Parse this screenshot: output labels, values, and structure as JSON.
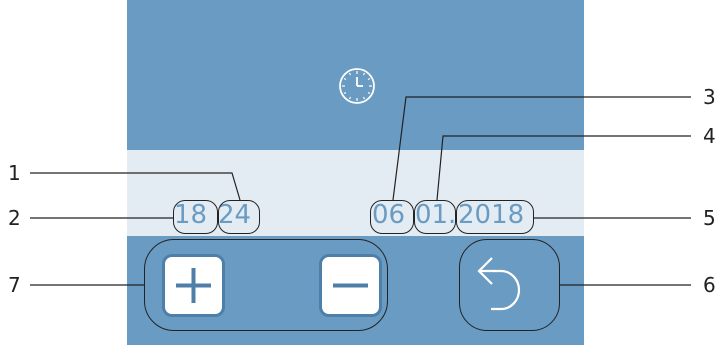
{
  "screen": {
    "background_color": "#6a9bc3",
    "band_color": "#e4ecf3",
    "icon": "clock-icon"
  },
  "time": {
    "hours": "18",
    "minutes": "24"
  },
  "date": {
    "day": "06",
    "month": "01",
    "separator": ".",
    "year": "2018"
  },
  "controls": {
    "increase_icon": "plus-icon",
    "decrease_icon": "minus-icon",
    "back_icon": "back-arrow-icon"
  },
  "callouts": {
    "minutes": "1",
    "hours": "2",
    "day": "3",
    "month": "4",
    "year": "5",
    "back": "6",
    "plus_minus": "7"
  }
}
